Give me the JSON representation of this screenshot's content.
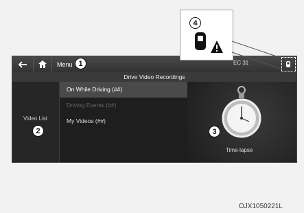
{
  "topbar": {
    "menu_label": "Menu",
    "clock": "EC 31"
  },
  "header": {
    "title": "Drive Video Recordings"
  },
  "sidebar": {
    "label": "Video List"
  },
  "list": {
    "items": [
      "On While Driving (##)",
      "Driving Events (##)",
      "My Videos (##)"
    ]
  },
  "preview": {
    "label": "Time-lapse"
  },
  "callouts": [
    "1",
    "2",
    "3",
    "4"
  ],
  "caption": "OJX1050221L"
}
